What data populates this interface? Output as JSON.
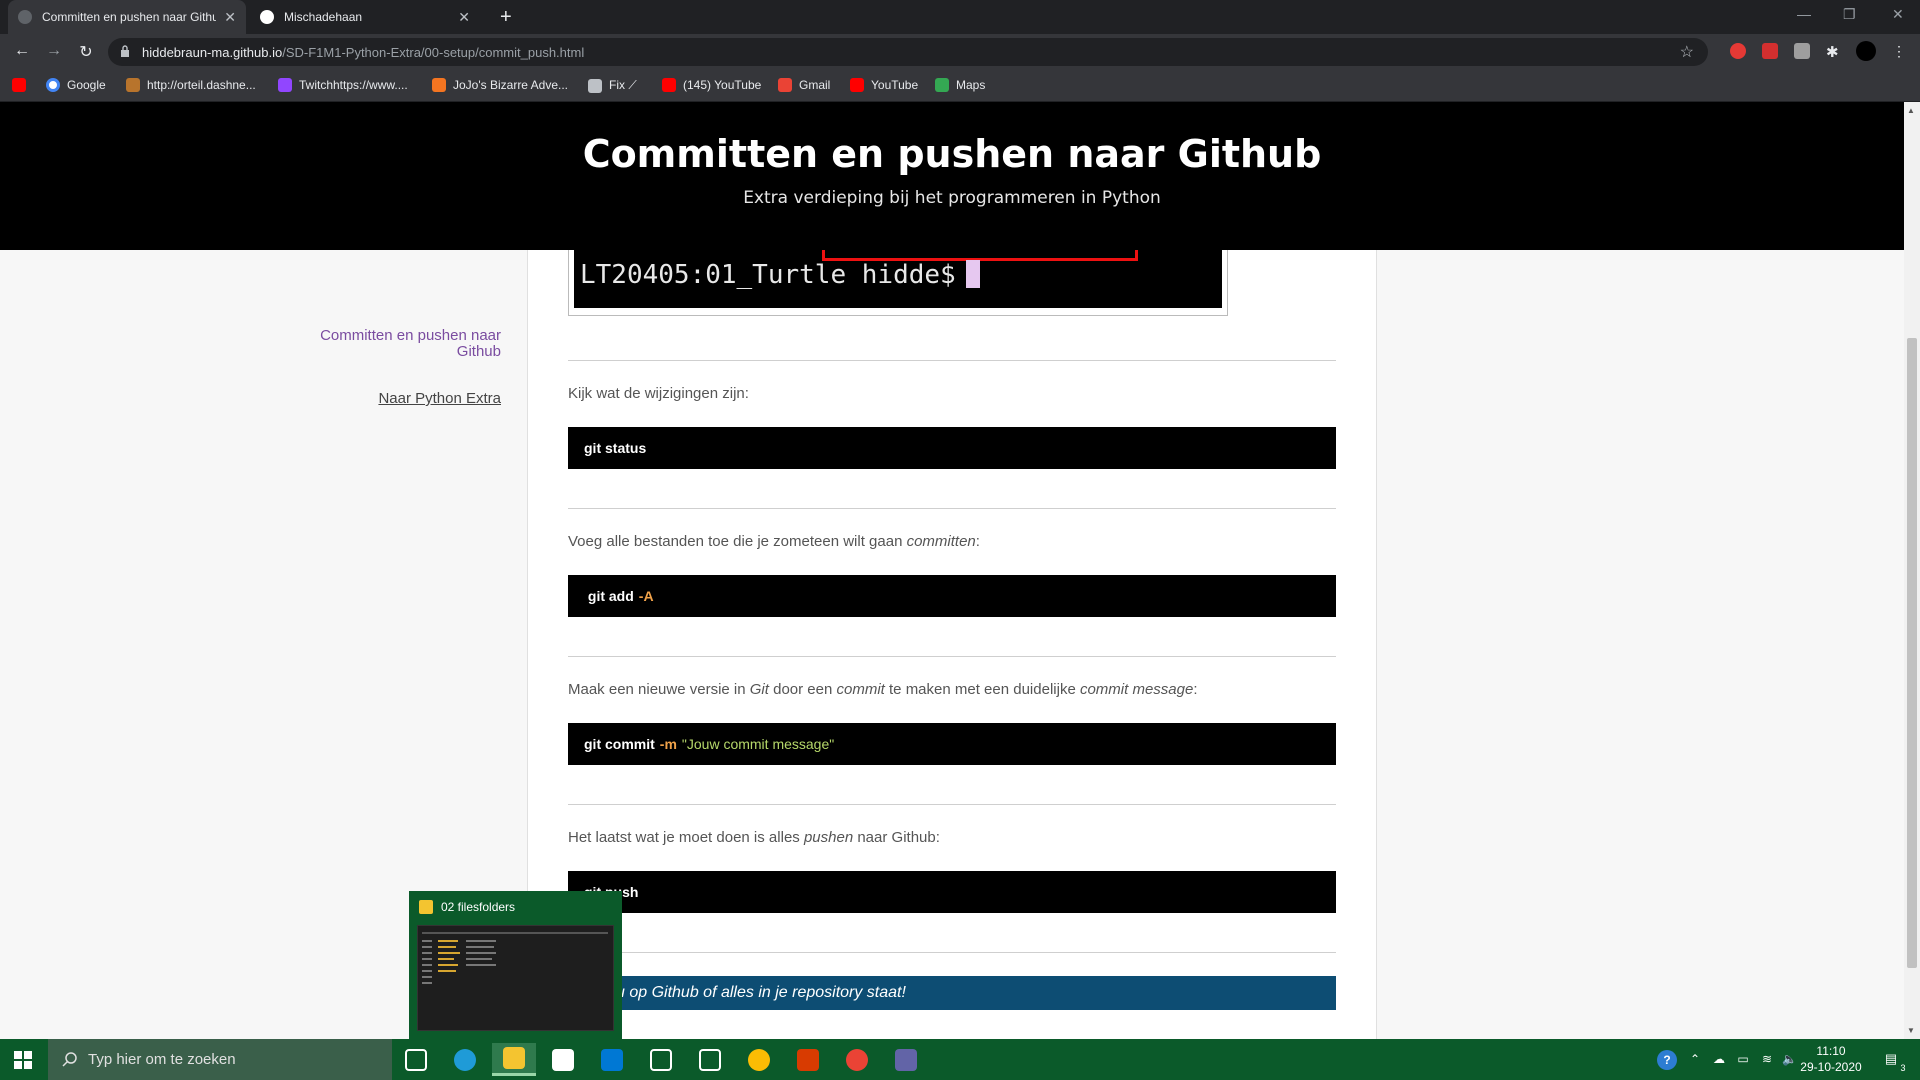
{
  "browser": {
    "tabs": [
      {
        "label": "Committen en pushen naar Github",
        "active": true
      },
      {
        "label": "Mischadehaan",
        "active": false
      }
    ],
    "close_glyph": "✕",
    "newtab_glyph": "+",
    "url_host": "hiddebraun-ma.github.io",
    "url_path": "/SD-F1M1-Python-Extra/00-setup/commit_push.html",
    "bookmarks": [
      {
        "label": "",
        "icon": "youtube-icon",
        "color": "#ff0000"
      },
      {
        "label": "Google",
        "icon": "google-icon",
        "color": "#ffffff"
      },
      {
        "label": "http://orteil.dashne...",
        "icon": "cookie-icon",
        "color": "#b8742c"
      },
      {
        "label": "Twitchhttps://www....",
        "icon": "twitch-icon",
        "color": "#9146ff"
      },
      {
        "label": "JoJo's Bizarre Adve...",
        "icon": "crunchyroll-icon",
        "color": "#f47521"
      },
      {
        "label": "Fix ⟋",
        "icon": "globe-icon",
        "color": "#bdc1c6"
      },
      {
        "label": "(145) YouTube",
        "icon": "youtube-icon",
        "color": "#ff0000"
      },
      {
        "label": "Gmail",
        "icon": "gmail-icon",
        "color": "#ea4335"
      },
      {
        "label": "YouTube",
        "icon": "youtube-icon",
        "color": "#ff0000"
      },
      {
        "label": "Maps",
        "icon": "maps-icon",
        "color": "#34a853"
      }
    ]
  },
  "page": {
    "title": "Committen en pushen naar Github",
    "subtitle": "Extra verdieping bij het programmeren in Python",
    "sidebar": {
      "current_link": "Committen en pushen naar Github",
      "back_link": "Naar Python Extra"
    },
    "terminal_prompt": "LT20405:01_Turtle hidde$",
    "steps": [
      {
        "desc_parts": [
          {
            "t": "Kijk wat de wijzigingen zijn:",
            "i": false
          }
        ],
        "code": {
          "cmd": "git status",
          "flag": "",
          "str": ""
        }
      },
      {
        "desc_parts": [
          {
            "t": "Voeg alle bestanden toe die je zometeen wilt gaan ",
            "i": false
          },
          {
            "t": "committen",
            "i": true
          },
          {
            "t": ":",
            "i": false
          }
        ],
        "code": {
          "cmd": " git add",
          "flag": "-A",
          "str": ""
        }
      },
      {
        "desc_parts": [
          {
            "t": "Maak een nieuwe versie in ",
            "i": false
          },
          {
            "t": "Git",
            "i": true
          },
          {
            "t": " door een ",
            "i": false
          },
          {
            "t": "commit",
            "i": true
          },
          {
            "t": " te maken met een duidelijke ",
            "i": false
          },
          {
            "t": "commit message",
            "i": true
          },
          {
            "t": ":",
            "i": false
          }
        ],
        "code": {
          "cmd": "git commit",
          "flag": "-m",
          "str": "\"Jouw commit message\""
        }
      },
      {
        "desc_parts": [
          {
            "t": "Het laatst wat je moet doen is alles ",
            "i": false
          },
          {
            "t": "pushen",
            "i": true
          },
          {
            "t": " naar Github:",
            "i": false
          }
        ],
        "code": {
          "cmd": "git push",
          "flag": "",
          "str": ""
        }
      }
    ],
    "callout": "u op Github of alles in je repository staat!"
  },
  "taskbar": {
    "search_placeholder": "Typ hier om te zoeken",
    "thumbnail_title": "02 filesfolders",
    "clock_time": "11:10",
    "clock_date": "29-10-2020",
    "notification_count": "3",
    "apps": [
      {
        "icon": "task-view-icon",
        "color": "#ffffff"
      },
      {
        "icon": "edge-icon",
        "color": "#1f9bd7"
      },
      {
        "icon": "file-explorer-icon",
        "color": "#f4c430"
      },
      {
        "icon": "store-icon",
        "color": "#ffffff"
      },
      {
        "icon": "mail-icon",
        "color": "#0078d4"
      },
      {
        "icon": "dropbox-icon",
        "color": "#ffffff"
      },
      {
        "icon": "bolt-icon",
        "color": "#ffffff"
      },
      {
        "icon": "chrome-icon",
        "color": "#fbbc04"
      },
      {
        "icon": "office-icon",
        "color": "#d83b01"
      },
      {
        "icon": "chrome-profile-icon",
        "color": "#ea4335"
      },
      {
        "icon": "teams-icon",
        "color": "#6264a7"
      }
    ]
  },
  "colors": {
    "accent_green": "#0b5a2a",
    "callout_blue": "#0d4d73",
    "link_purple": "#7a4ca0"
  }
}
